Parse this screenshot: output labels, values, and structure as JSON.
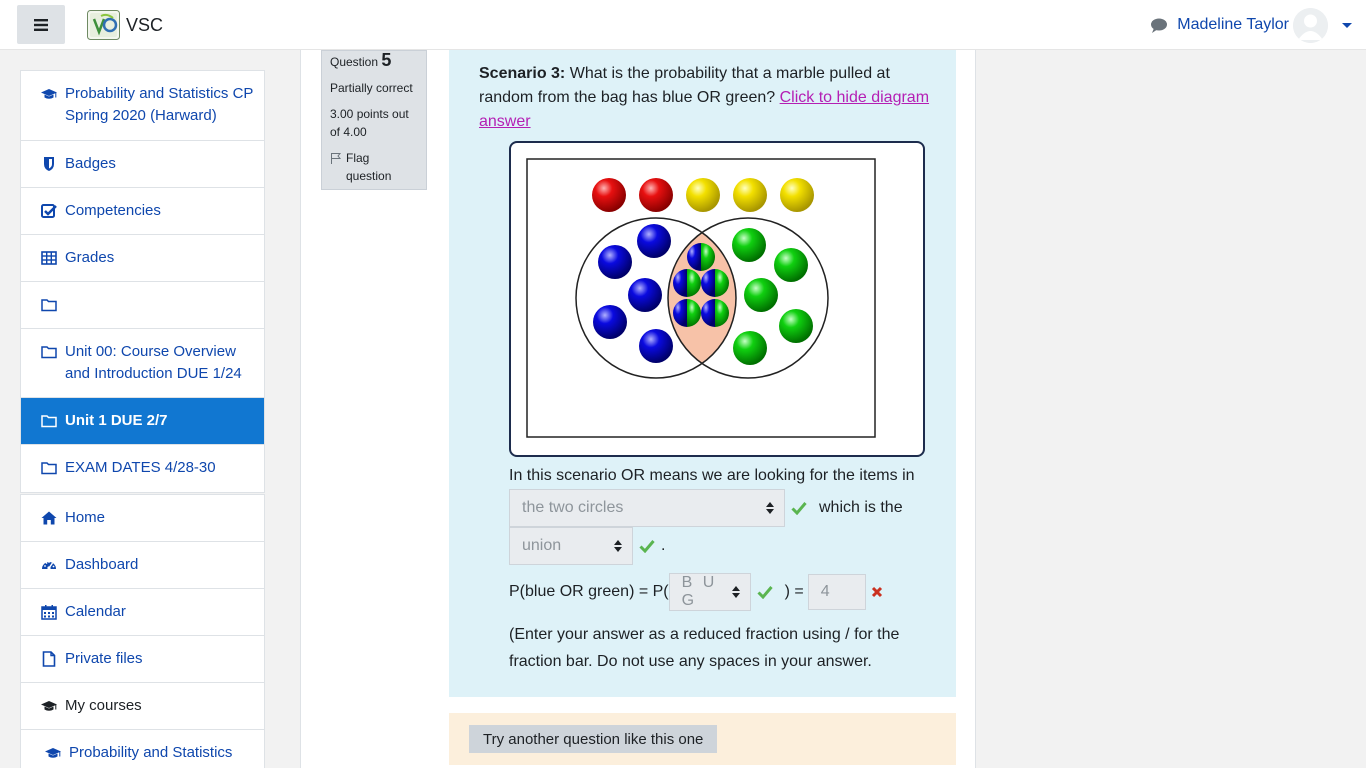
{
  "navbar": {
    "brand": "VSC",
    "user_name": "Madeline Taylor"
  },
  "drawer": {
    "course_items": [
      {
        "label": "Probability and Statistics CP Spring 2020 (Harward)",
        "icon": "graduation-cap-icon"
      },
      {
        "label": "Badges",
        "icon": "shield-icon"
      },
      {
        "label": "Competencies",
        "icon": "check-square-icon"
      },
      {
        "label": "Grades",
        "icon": "table-icon"
      },
      {
        "label": "",
        "icon": "folder-icon"
      },
      {
        "label": "Unit 00: Course Overview and Introduction DUE 1/24",
        "icon": "folder-icon"
      },
      {
        "label": "Unit 1 DUE 2/7",
        "icon": "folder-icon",
        "active": true
      },
      {
        "label": "EXAM DATES 4/28-30",
        "icon": "folder-icon"
      }
    ],
    "site_items": [
      {
        "label": "Home",
        "icon": "home-icon"
      },
      {
        "label": "Dashboard",
        "icon": "dashboard-icon"
      },
      {
        "label": "Calendar",
        "icon": "calendar-icon"
      },
      {
        "label": "Private files",
        "icon": "file-icon"
      },
      {
        "label": "My courses",
        "icon": "graduation-cap-icon"
      },
      {
        "label": "Probability and Statistics",
        "icon": "graduation-cap-icon"
      }
    ]
  },
  "question_info": {
    "label": "Question",
    "number": "5",
    "state": "Partially correct",
    "grade": "3.00 points out of 4.00",
    "flag": "Flag question"
  },
  "question": {
    "scenario_label": "Scenario 3:",
    "prompt": " What is the probability that a marble pulled at random from the bag has blue OR green? ",
    "hide_link": "Click to hide diagram answer",
    "line1": "In this scenario OR means we are looking for the items in",
    "select1_value": "the two circles",
    "after_select1": "which is the",
    "select2_value": "union",
    "period": ".",
    "formula_left": "P(blue OR green) = P(",
    "select3_value": "B U G",
    "formula_mid": ") =",
    "answer_value": "4",
    "note": "(Enter your answer as a reduced fraction using / for the fraction bar. Do not use any spaces in your answer."
  },
  "footer": {
    "try_button": "Try another question like this one"
  },
  "colors": {
    "link": "#0f47ad",
    "active": "#1177d1",
    "correct": "#5ab550",
    "incorrect": "#ca3120"
  }
}
